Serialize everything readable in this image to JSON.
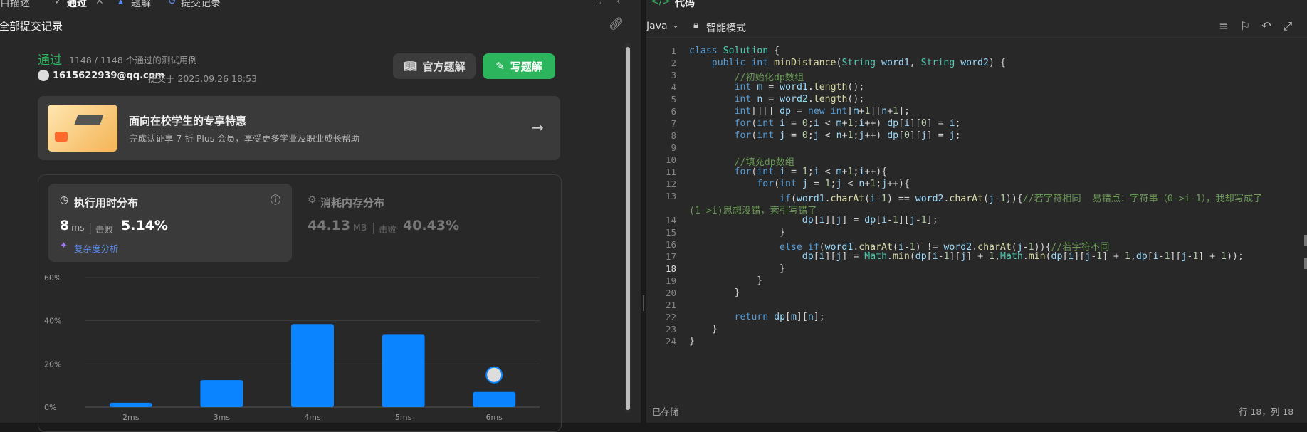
{
  "tabs": [
    "目描述",
    "通过",
    "题解",
    "提交记录"
  ],
  "submissions_title": "全部提交记录",
  "result": {
    "status": "通过",
    "summary": "1148 / 1148 个通过的测试用例",
    "user": "1615622939@qq.com",
    "submitted": "提交于 2025.09.26 18:53",
    "official_btn": "官方题解",
    "write_btn": "写题解"
  },
  "promo": {
    "title": "面向在校学生的专享特惠",
    "subtitle": "完成认证享 7 折 Plus 会员，享受更多学业及职业成长帮助"
  },
  "runtime": {
    "label": "执行用时分布",
    "value": "8",
    "unit": "ms",
    "beats_label": "击败",
    "beats": "5.14%",
    "complexity": "复杂度分析"
  },
  "memory": {
    "label": "消耗内存分布",
    "value": "44.13",
    "unit": "MB",
    "beats_label": "击败",
    "beats": "40.43%"
  },
  "chart_data": {
    "type": "bar",
    "categories": [
      "2ms",
      "3ms",
      "4ms",
      "5ms",
      "6ms"
    ],
    "values": [
      2,
      12.5,
      38.5,
      33.5,
      7
    ],
    "yticks": [
      "60%",
      "40%",
      "20%",
      "0%"
    ],
    "ylim": [
      0,
      60
    ],
    "grid": true,
    "color": "#0a84ff"
  },
  "editor": {
    "title": "代码",
    "language": "Java",
    "mode": "智能模式",
    "status": "已存储",
    "cursor": "行 18，列 18"
  },
  "code": [
    "class Solution {",
    "    public int minDistance(String word1, String word2) {",
    "        //初始化dp数组",
    "        int m = word1.length();",
    "        int n = word2.length();",
    "        int[][] dp = new int[m+1][n+1];",
    "        for(int i = 0;i < m+1;i++) dp[i][0] = i;",
    "        for(int j = 0;j < n+1;j++) dp[0][j] = j;",
    "",
    "        //填充dp数组",
    "        for(int i = 1;i < m+1;i++){",
    "            for(int j = 1;j < n+1;j++){",
    "                if(word1.charAt(i-1) == word2.charAt(j-1)){//若字符相同  易错点：字符串（0->i-1），我却写成了",
    "(1->i)思想没错，索引写错了",
    "                    dp[i][j] = dp[i-1][j-1];",
    "                }",
    "                else if(word1.charAt(i-1) != word2.charAt(j-1)){//若字符不同",
    "                    dp[i][j] = Math.min(dp[i-1][j] + 1,Math.min(dp[i][j-1] + 1,dp[i-1][j-1] + 1));",
    "                }",
    "            }",
    "        }",
    "",
    "        return dp[m][n];",
    "    }",
    "}"
  ],
  "line_numbers": [
    "1",
    "2",
    "3",
    "4",
    "5",
    "6",
    "7",
    "8",
    "9",
    "10",
    "11",
    "12",
    "13",
    "",
    "14",
    "15",
    "16",
    "17",
    "18",
    "19",
    "20",
    "21",
    "22",
    "23",
    "24"
  ]
}
